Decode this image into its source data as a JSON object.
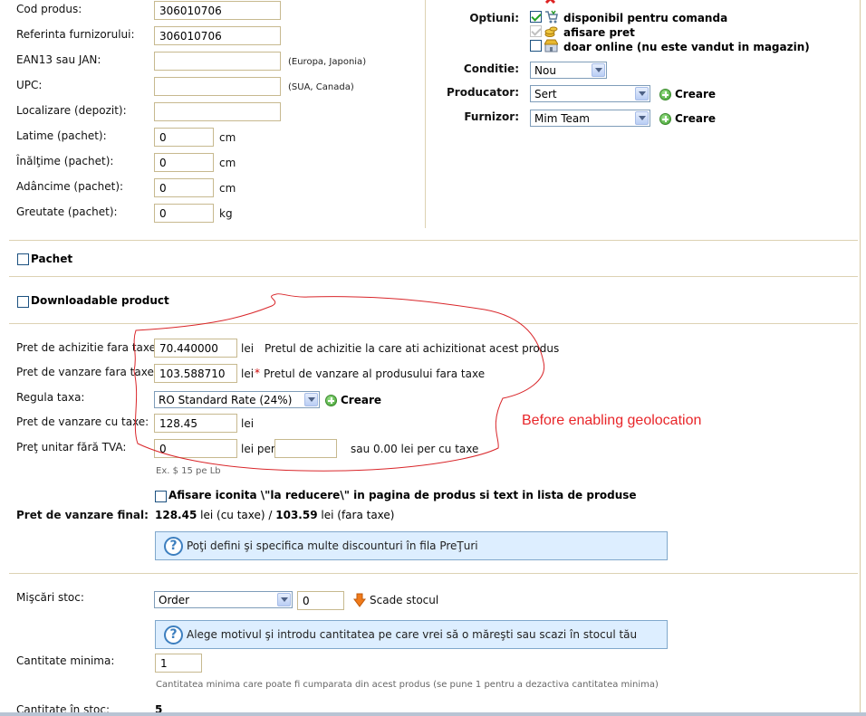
{
  "left_fields": [
    {
      "label": "Cod produs:",
      "value": "306010706",
      "hint": "",
      "unit": ""
    },
    {
      "label": "Referinta furnizorului:",
      "value": "306010706",
      "hint": "",
      "unit": ""
    },
    {
      "label": "EAN13 sau JAN:",
      "value": "",
      "hint": "(Europa, Japonia)",
      "unit": ""
    },
    {
      "label": "UPC:",
      "value": "",
      "hint": "(SUA, Canada)",
      "unit": ""
    },
    {
      "label": "Localizare (depozit):",
      "value": "",
      "hint": "",
      "unit": ""
    },
    {
      "label": "Latime (pachet):",
      "value": "0",
      "hint": "",
      "unit": "cm"
    },
    {
      "label": "Înălţime (pachet):",
      "value": "0",
      "hint": "",
      "unit": "cm"
    },
    {
      "label": "Adâncime (pachet):",
      "value": "0",
      "hint": "",
      "unit": "cm"
    },
    {
      "label": "Greutate (pachet):",
      "value": "0",
      "hint": "",
      "unit": "kg"
    }
  ],
  "options": {
    "label": "Optiuni:",
    "items": [
      {
        "label": "disponibil pentru comanda",
        "checked": true,
        "disabled": false
      },
      {
        "label": "afisare pret",
        "checked": true,
        "disabled": true
      },
      {
        "label": "doar online (nu este vandut in magazin)",
        "checked": false,
        "disabled": false
      }
    ]
  },
  "condition": {
    "label": "Conditie:",
    "value": "Nou"
  },
  "manufacturer": {
    "label": "Producator:",
    "value": "Sert",
    "create": "Creare"
  },
  "supplier": {
    "label": "Furnizor:",
    "value": "Mim Team",
    "create": "Creare"
  },
  "pack": {
    "label": "Pachet"
  },
  "downloadable": {
    "label": "Downloadable product"
  },
  "pricing": {
    "purchase_label": "Pret de achizitie fara taxe:",
    "purchase_value": "70.440000",
    "purchase_unit": "lei",
    "purchase_desc": "Pretul de achizitie la care ati achizitionat acest produs",
    "sale_label": "Pret de vanzare fara taxe:",
    "sale_value": "103.588710",
    "sale_unit": "lei",
    "sale_star": "*",
    "sale_desc": "Pretul de vanzare al produsului fara taxe",
    "tax_label": "Regula taxa:",
    "tax_value": "RO Standard Rate (24%)",
    "tax_create": "Creare",
    "sale_tax_label": "Pret de vanzare cu taxe:",
    "sale_tax_value": "128.45",
    "sale_tax_unit": "lei",
    "unit_label": "Preţ unitar fără TVA:",
    "unit_value": "0",
    "unit_per": "lei per",
    "unit_per_value": "",
    "unit_note": "sau 0.00 lei per cu taxe",
    "unit_example": "Ex. $ 15 pe Lb"
  },
  "annotation": "Before enabling geolocation",
  "reduction": {
    "label": "Afisare iconita \\\"la reducere\\\" in pagina de produs si text in lista de produse"
  },
  "final_price": {
    "label": "Pret de vanzare final:",
    "with_tax": "128.45",
    "with_tax_text": "lei (cu taxe) /",
    "without_tax": "103.59",
    "without_tax_text": "lei (fara taxe)"
  },
  "discount_info": "Poţi defini şi specifica multe discounturi în fila PreŢuri",
  "stock": {
    "label": "Mişcări stoc:",
    "reason": "Order",
    "qty": "0",
    "action": "Scade stocul",
    "info": "Alege motivul şi introdu cantitatea pe care vrei să o măreşti sau scazi în stocul tău"
  },
  "min_qty": {
    "label": "Cantitate minima:",
    "value": "1",
    "hint": "Cantitatea minima care poate fi cumparata din acest produs (se pune 1 pentru a dezactiva cantitatea minima)"
  },
  "in_stock": {
    "label": "Cantitate în stoc:",
    "value": "5"
  },
  "colors": {
    "annotation": "#e8262a",
    "info_bg": "#ddeeff",
    "border": "#c7b98f"
  }
}
